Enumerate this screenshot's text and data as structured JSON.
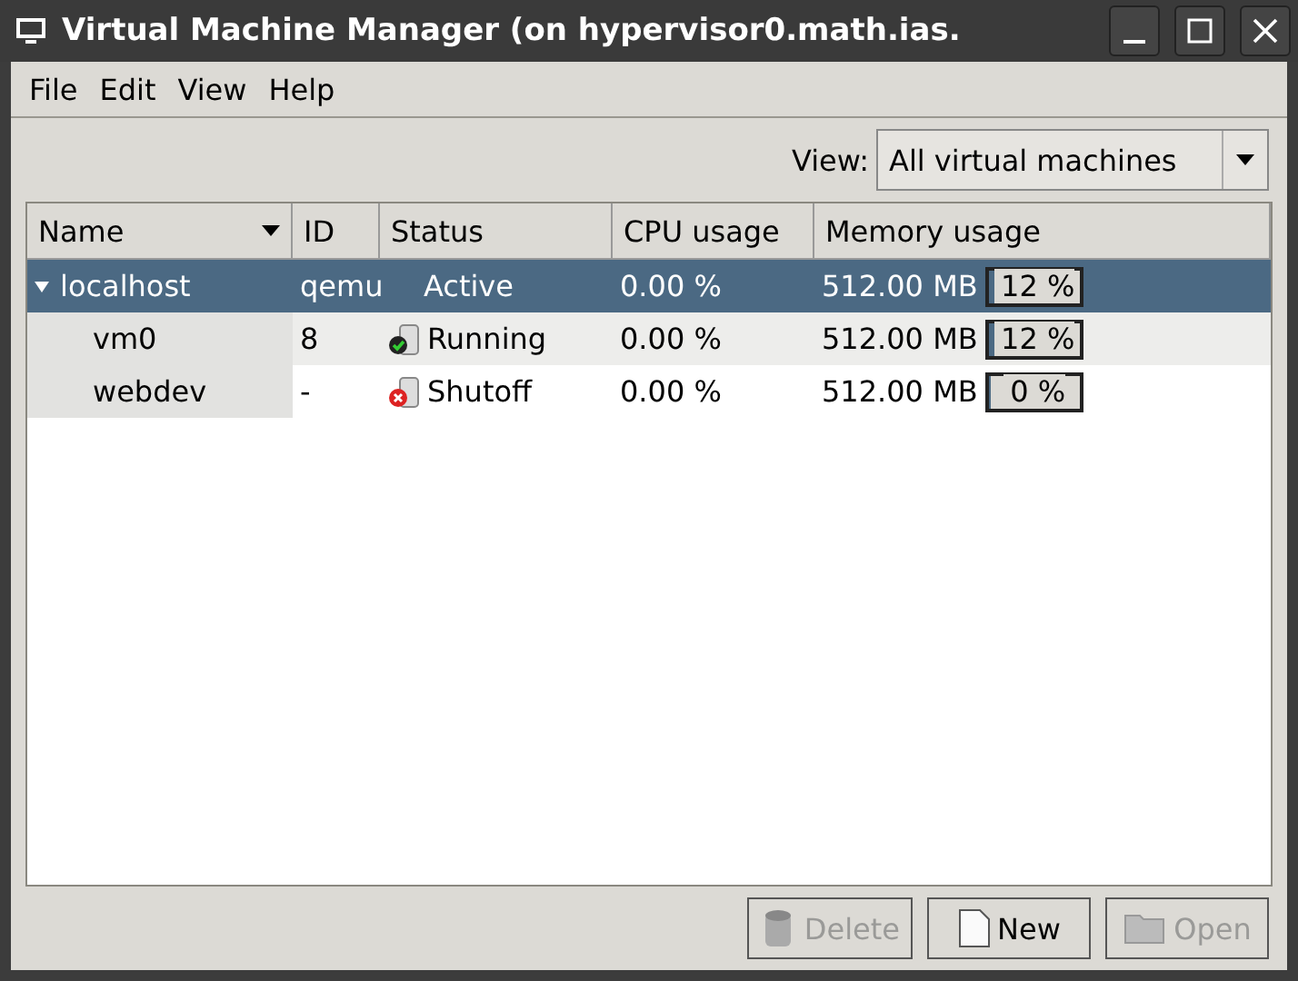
{
  "window": {
    "title": "Virtual Machine Manager (on hypervisor0.math.ias."
  },
  "menu": [
    "File",
    "Edit",
    "View",
    "Help"
  ],
  "view_filter": {
    "label": "View:",
    "value": "All virtual machines"
  },
  "table": {
    "columns": [
      {
        "label": "Name",
        "sorted": true
      },
      {
        "label": "ID",
        "sorted": false
      },
      {
        "label": "Status",
        "sorted": false
      },
      {
        "label": "CPU usage",
        "sorted": false
      },
      {
        "label": "Memory usage",
        "sorted": false
      }
    ],
    "rows": [
      {
        "name": "localhost",
        "id": "qemu",
        "status": "Active",
        "kind": "host",
        "cpu": "0.00 %",
        "memory": "512.00 MB",
        "mem_pct": "12 %",
        "level": 0.12,
        "selected": true,
        "expanded": true,
        "children": [
          {
            "name": "vm0",
            "id": "8",
            "status": "Running",
            "kind": "running",
            "cpu": "0.00 %",
            "memory": "512.00 MB",
            "mem_pct": "12 %",
            "level": 0.12,
            "selected": false
          },
          {
            "name": "webdev",
            "id": "-",
            "status": "Shutoff",
            "kind": "shutoff",
            "cpu": "0.00 %",
            "memory": "512.00 MB",
            "mem_pct": "0 %",
            "level": 0,
            "selected": false
          }
        ]
      }
    ]
  },
  "buttons": [
    {
      "label": "Delete",
      "disabled": true,
      "kind": "delete"
    },
    {
      "label": "New",
      "disabled": false,
      "kind": "new"
    },
    {
      "label": "Open",
      "disabled": true,
      "kind": "open"
    }
  ]
}
